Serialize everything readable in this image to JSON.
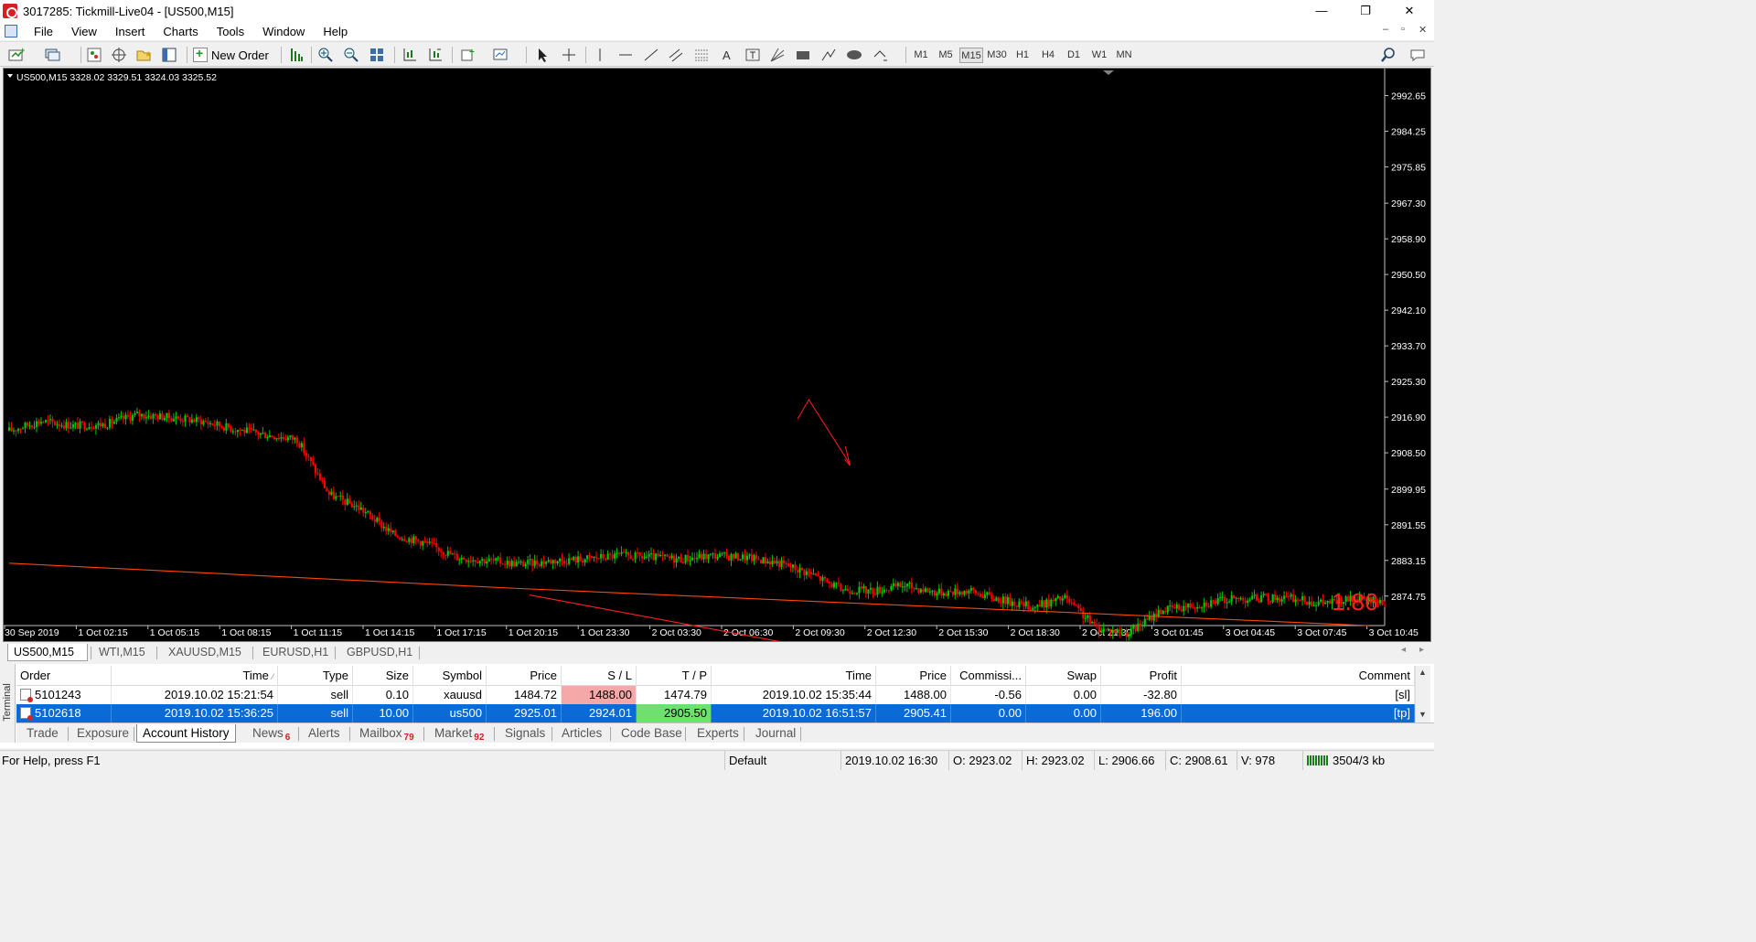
{
  "window": {
    "title": "3017285: Tickmill-Live04 - [US500,M15]",
    "controls": [
      "—",
      "❐",
      "✕"
    ],
    "mdi_controls": [
      "–",
      "▫",
      "✕"
    ]
  },
  "menu": [
    "File",
    "View",
    "Insert",
    "Charts",
    "Tools",
    "Window",
    "Help"
  ],
  "toolbar": {
    "new_order": "New Order",
    "timeframes": [
      "M1",
      "M5",
      "M15",
      "M30",
      "H1",
      "H4",
      "D1",
      "W1",
      "MN"
    ],
    "active_timeframe": "M15",
    "text_tool": "A"
  },
  "chart_data": {
    "type": "candlestick",
    "symbol_header": "US500,M15  3328.02 3329.51 3324.03 3325.52",
    "y_ticks": [
      "2992.65",
      "2984.25",
      "2975.85",
      "2967.30",
      "2958.90",
      "2950.50",
      "2942.10",
      "2933.70",
      "2925.30",
      "2916.90",
      "2908.50",
      "2899.95",
      "2891.55",
      "2883.15",
      "2874.75"
    ],
    "x_ticks": [
      "30 Sep 2019",
      "1 Oct 02:15",
      "1 Oct 05:15",
      "1 Oct 08:15",
      "1 Oct 11:15",
      "1 Oct 14:15",
      "1 Oct 17:15",
      "1 Oct 20:15",
      "1 Oct 23:30",
      "2 Oct 03:30",
      "2 Oct 06:30",
      "2 Oct 09:30",
      "2 Oct 12:30",
      "2 Oct 15:30",
      "2 Oct 18:30",
      "2 Oct 21:30",
      "3 Oct 01:45",
      "3 Oct 04:45",
      "3 Oct 07:45",
      "3 Oct 10:45"
    ],
    "price_path": [
      [
        0,
        2913.7
      ],
      [
        14,
        2916.0
      ],
      [
        28,
        2914.9
      ],
      [
        42,
        2915.2
      ],
      [
        56,
        2917.5
      ],
      [
        70,
        2916.9
      ],
      [
        84,
        2916.0
      ],
      [
        98,
        2914.2
      ],
      [
        112,
        2912.8
      ],
      [
        126,
        2911.7
      ],
      [
        140,
        2898.7
      ],
      [
        154,
        2895.3
      ],
      [
        168,
        2889.3
      ],
      [
        182,
        2887.3
      ],
      [
        196,
        2883.9
      ],
      [
        210,
        2883.1
      ],
      [
        224,
        2882.3
      ],
      [
        238,
        2883.1
      ],
      [
        252,
        2883.5
      ],
      [
        266,
        2884.3
      ],
      [
        280,
        2883.9
      ],
      [
        294,
        2883.5
      ],
      [
        308,
        2884.3
      ],
      [
        322,
        2883.9
      ],
      [
        336,
        2882.7
      ],
      [
        350,
        2880.2
      ],
      [
        364,
        2876.4
      ],
      [
        378,
        2876.0
      ],
      [
        392,
        2877.3
      ],
      [
        406,
        2875.6
      ],
      [
        420,
        2876.0
      ],
      [
        434,
        2873.9
      ],
      [
        448,
        2872.2
      ],
      [
        462,
        2874.3
      ],
      [
        476,
        2867.2
      ],
      [
        490,
        2866.0
      ],
      [
        504,
        2871.4
      ],
      [
        518,
        2872.6
      ],
      [
        532,
        2873.9
      ],
      [
        546,
        2874.3
      ],
      [
        560,
        2874.3
      ],
      [
        574,
        2873.1
      ],
      [
        588,
        2873.9
      ],
      [
        602,
        2873.5
      ]
    ],
    "trend_lines": [
      {
        "from": [
          0,
          2882.5
        ],
        "to": [
          66,
          2876.5
        ],
        "color": "#ff4500"
      },
      {
        "from": [
          66,
          2876.5
        ],
        "to": [
          175,
          2867.8
        ],
        "color": "#ff4500"
      },
      {
        "from": [
          67,
          2875.0
        ],
        "to": [
          130,
          2853.5
        ],
        "color": "#ff2020"
      }
    ],
    "last_value_label": "1.86",
    "background": "#000000",
    "bull_color": "#00c800",
    "bear_color": "#ff0000"
  },
  "symbol_tabs": [
    "US500,M15",
    "WTI,M15",
    "XAUUSD,M15",
    "EURUSD,H1",
    "GBPUSD,H1"
  ],
  "terminal": {
    "label": "Terminal",
    "columns": [
      "Order",
      "Time",
      "Type",
      "Size",
      "Symbol",
      "Price",
      "S / L",
      "T / P",
      "Time",
      "Price",
      "Commissi...",
      "Swap",
      "Profit",
      "Comment"
    ],
    "rows": [
      [
        "5101243",
        "2019.10.02 15:21:54",
        "sell",
        "0.10",
        "xauusd",
        "1484.72",
        "1488.00",
        "1474.79",
        "2019.10.02 15:35:44",
        "1488.00",
        "-0.56",
        "0.00",
        "-32.80",
        "[sl]"
      ],
      [
        "5102618",
        "2019.10.02 15:36:25",
        "sell",
        "10.00",
        "us500",
        "2925.01",
        "2924.01",
        "2905.50",
        "2019.10.02 16:51:57",
        "2905.41",
        "0.00",
        "0.00",
        "196.00",
        "[tp]"
      ]
    ],
    "tabs": [
      {
        "label": "Trade",
        "badge": ""
      },
      {
        "label": "Exposure",
        "badge": ""
      },
      {
        "label": "Account History",
        "badge": ""
      },
      {
        "label": "News",
        "badge": "6"
      },
      {
        "label": "Alerts",
        "badge": ""
      },
      {
        "label": "Mailbox",
        "badge": "79"
      },
      {
        "label": "Market",
        "badge": "92"
      },
      {
        "label": "Signals",
        "badge": ""
      },
      {
        "label": "Articles",
        "badge": ""
      },
      {
        "label": "Code Base",
        "badge": ""
      },
      {
        "label": "Experts",
        "badge": ""
      },
      {
        "label": "Journal",
        "badge": ""
      }
    ],
    "active_tab": "Account History"
  },
  "statusbar": {
    "help": "For Help, press F1",
    "profile": "Default",
    "datetime": "2019.10.02 16:30",
    "open": "O: 2923.02",
    "high": "H: 2923.02",
    "low": "L: 2906.66",
    "close": "C: 2908.61",
    "volume": "V: 978",
    "traffic": "3504/3 kb"
  }
}
